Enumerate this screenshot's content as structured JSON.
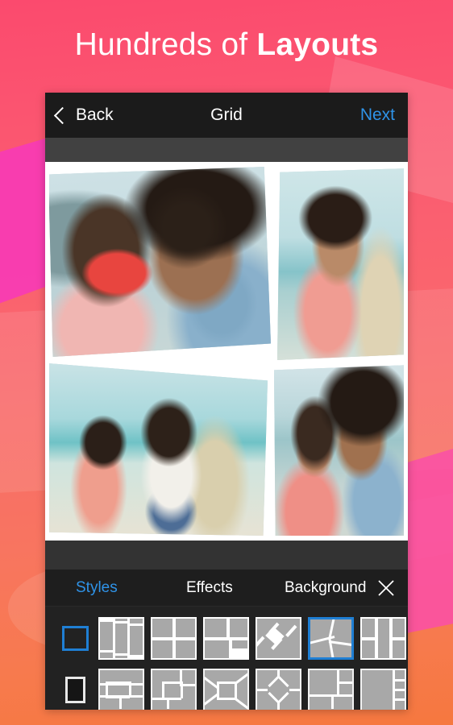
{
  "headline": {
    "text_regular": "Hundreds of ",
    "text_bold": "Layouts"
  },
  "colors": {
    "background_top": "#fb4a6e",
    "background_bottom": "#f6783f",
    "accent_blue": "#2f93e8",
    "selection_blue": "#1f7fd4",
    "panel_dark": "#1b1b1b",
    "thumb_gray": "#a8a8a8"
  },
  "phone": {
    "navbar": {
      "back_label": "Back",
      "back_icon": "chevron-left-icon",
      "title": "Grid",
      "next_label": "Next"
    },
    "toolbar": {
      "tabs": [
        {
          "label": "Styles",
          "active": true
        },
        {
          "label": "Effects",
          "active": false
        },
        {
          "label": "Background",
          "active": false
        }
      ],
      "close_icon": "close-x-icon"
    },
    "ratio_selectors": [
      {
        "name": "square-ratio",
        "selected": true
      },
      {
        "name": "portrait-ratio",
        "selected": false
      }
    ],
    "layout_thumbnails": {
      "row1": [
        {
          "id": "three-vertical-panels",
          "selected": false
        },
        {
          "id": "two-by-two-grid",
          "selected": false
        },
        {
          "id": "two-by-two-offset-grid",
          "selected": false
        },
        {
          "id": "pinwheel-diamond",
          "selected": false
        },
        {
          "id": "slanted-four-split",
          "selected": true
        },
        {
          "id": "three-columns-split-right",
          "selected": false
        }
      ],
      "row2": [
        {
          "id": "center-horizontal-band",
          "selected": false
        },
        {
          "id": "nested-corner-squares",
          "selected": false
        },
        {
          "id": "center-frame-perspective",
          "selected": false
        },
        {
          "id": "diamond-center",
          "selected": false
        },
        {
          "id": "large-left-with-stack",
          "selected": false
        },
        {
          "id": "large-left-with-four-strips",
          "selected": false
        }
      ]
    },
    "collage": {
      "layout": "slanted-four-split",
      "photos": [
        {
          "id": "photo-couple-with-red-camera",
          "position": "top-left"
        },
        {
          "id": "photo-woman-with-surfboard",
          "position": "top-right"
        },
        {
          "id": "photo-couple-walking-beach",
          "position": "bottom-left"
        },
        {
          "id": "photo-couple-selfie",
          "position": "bottom-right"
        }
      ]
    }
  }
}
